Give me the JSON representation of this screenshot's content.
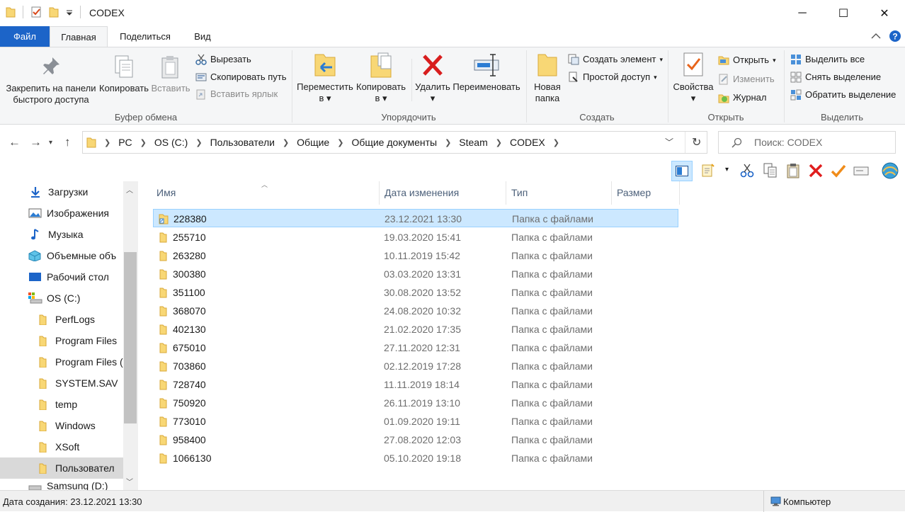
{
  "window": {
    "title": "CODEX",
    "minimize": "─",
    "maximize": "☐",
    "close": "✕"
  },
  "ribbon_tabs": [
    "Файл",
    "Главная",
    "Поделиться",
    "Вид"
  ],
  "ribbon": {
    "clipboard": {
      "pin_line1": "Закрепить на панели",
      "pin_line2": "быстрого доступа",
      "copy": "Копировать",
      "paste": "Вставить",
      "cut": "Вырезать",
      "copy_path": "Скопировать путь",
      "paste_shortcut": "Вставить ярлык",
      "label": "Буфер обмена"
    },
    "organize": {
      "move_line1": "Переместить",
      "move_line2": "в",
      "copy_line1": "Копировать",
      "copy_line2": "в",
      "delete": "Удалить",
      "rename": "Переименовать",
      "label": "Упорядочить"
    },
    "new": {
      "folder_line1": "Новая",
      "folder_line2": "папка",
      "new_item": "Создать элемент",
      "easy_access": "Простой доступ",
      "label": "Создать"
    },
    "open": {
      "properties": "Свойства",
      "open": "Открыть",
      "edit": "Изменить",
      "history": "Журнал",
      "label": "Открыть"
    },
    "select": {
      "select_all": "Выделить все",
      "select_none": "Снять выделение",
      "invert": "Обратить выделение",
      "label": "Выделить"
    }
  },
  "address": {
    "crumbs": [
      "PC",
      "OS (C:)",
      "Пользователи",
      "Общие",
      "Общие документы",
      "Steam",
      "CODEX"
    ],
    "search_placeholder": "Поиск: CODEX"
  },
  "nav_pane": [
    {
      "label": "Загрузки",
      "icon": "download-icon"
    },
    {
      "label": "Изображения",
      "icon": "pictures-icon"
    },
    {
      "label": "Музыка",
      "icon": "music-icon"
    },
    {
      "label": "Объемные объ",
      "icon": "3d-objects-icon"
    },
    {
      "label": "Рабочий стол",
      "icon": "desktop-icon"
    },
    {
      "label": "OS (C:)",
      "icon": "drive-icon"
    },
    {
      "label": "PerfLogs",
      "icon": "folder-icon"
    },
    {
      "label": "Program Files",
      "icon": "folder-icon"
    },
    {
      "label": "Program Files (",
      "icon": "folder-icon"
    },
    {
      "label": "SYSTEM.SAV",
      "icon": "folder-icon"
    },
    {
      "label": "temp",
      "icon": "folder-icon"
    },
    {
      "label": "Windows",
      "icon": "folder-icon"
    },
    {
      "label": "XSoft",
      "icon": "folder-icon"
    },
    {
      "label": "Пользовател",
      "icon": "folder-icon"
    },
    {
      "label": "Samsung (D:)",
      "icon": "drive-icon"
    }
  ],
  "columns": [
    "Имя",
    "Дата изменения",
    "Тип",
    "Размер"
  ],
  "files": [
    {
      "name": "228380",
      "date": "23.12.2021 13:30",
      "type": "Папка с файлами"
    },
    {
      "name": "255710",
      "date": "19.03.2020 15:41",
      "type": "Папка с файлами"
    },
    {
      "name": "263280",
      "date": "10.11.2019 15:42",
      "type": "Папка с файлами"
    },
    {
      "name": "300380",
      "date": "03.03.2020 13:31",
      "type": "Папка с файлами"
    },
    {
      "name": "351100",
      "date": "30.08.2020 13:52",
      "type": "Папка с файлами"
    },
    {
      "name": "368070",
      "date": "24.08.2020 10:32",
      "type": "Папка с файлами"
    },
    {
      "name": "402130",
      "date": "21.02.2020 17:35",
      "type": "Папка с файлами"
    },
    {
      "name": "675010",
      "date": "27.11.2020 12:31",
      "type": "Папка с файлами"
    },
    {
      "name": "703860",
      "date": "02.12.2019 17:28",
      "type": "Папка с файлами"
    },
    {
      "name": "728740",
      "date": "11.11.2019 18:14",
      "type": "Папка с файлами"
    },
    {
      "name": "750920",
      "date": "26.11.2019 13:10",
      "type": "Папка с файлами"
    },
    {
      "name": "773010",
      "date": "01.09.2020 19:11",
      "type": "Папка с файлами"
    },
    {
      "name": "958400",
      "date": "27.08.2020 12:03",
      "type": "Папка с файлами"
    },
    {
      "name": "1066130",
      "date": "05.10.2020 19:18",
      "type": "Папка с файлами"
    }
  ],
  "status": {
    "created": "Дата создания: 23.12.2021 13:30",
    "computer": "Компьютер"
  },
  "colors": {
    "accent": "#1c64c8",
    "selection": "#cce8ff",
    "folder": "#f8d775"
  }
}
